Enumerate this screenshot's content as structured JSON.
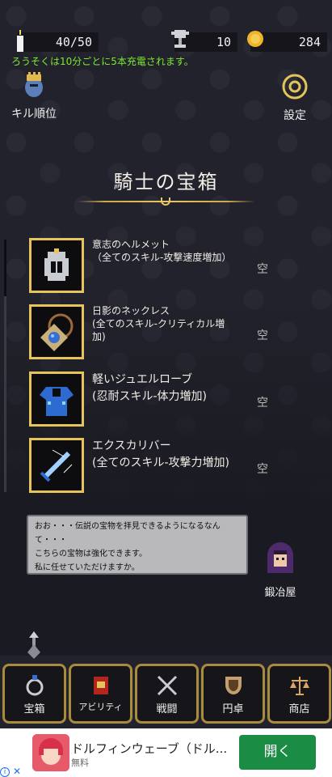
{
  "status": {
    "candles": "40/50",
    "trophies": "10",
    "coins": "284",
    "notice": "ろうそくは10分ごとに5本充電されます。"
  },
  "side": {
    "ranking_label": "キル順位",
    "settings_label": "設定"
  },
  "chest": {
    "title": "騎士の宝箱"
  },
  "items": [
    {
      "name": "意志のヘルメット\n（全てのスキル-攻撃速度増加）",
      "slot": "空"
    },
    {
      "name": "日影のネックレス\n(全てのスキル-クリティカル増\n加)",
      "slot": "空"
    },
    {
      "name": "軽いジュエルローブ\n(忍耐スキル-体力増加)",
      "slot": "空"
    },
    {
      "name": "エクスカリバー\n(全てのスキル-攻撃力増加)",
      "slot": "空"
    }
  ],
  "dialog": {
    "line1": "おお・・・伝説の宝物を拝見できるようになるなんて・・・",
    "line2": "こちらの宝物は強化できます。",
    "line3": "私に任せていただけますか。"
  },
  "smith": {
    "label": "鍛冶屋"
  },
  "nav": [
    {
      "label": "宝箱",
      "icon": "ring-icon"
    },
    {
      "label": "アビリティ",
      "icon": "book-icon"
    },
    {
      "label": "戦闘",
      "icon": "crossed-swords-icon"
    },
    {
      "label": "円卓",
      "icon": "shield-icon"
    },
    {
      "label": "商店",
      "icon": "scales-icon"
    }
  ],
  "ad": {
    "title": "ドルフィンウェーブ（ドル...",
    "subtitle": "無料",
    "button": "開く"
  }
}
